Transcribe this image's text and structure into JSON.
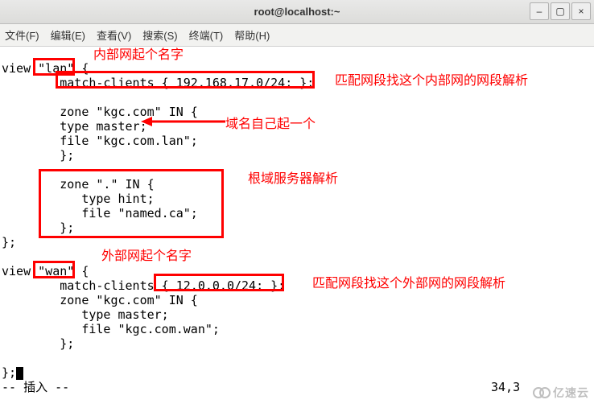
{
  "window": {
    "title": "root@localhost:~",
    "min_icon": "–",
    "max_icon": "▢",
    "close_icon": "×"
  },
  "menubar": {
    "file": "文件(F)",
    "edit": "编辑(E)",
    "view": "查看(V)",
    "search": "搜索(S)",
    "terminal": "终端(T)",
    "help": "帮助(H)"
  },
  "code": {
    "l1": "view \"lan\" {",
    "l2": "        match-clients { 192.168.17.0/24; };",
    "l3": "",
    "l4": "        zone \"kgc.com\" IN {",
    "l5": "        type master;",
    "l6": "        file \"kgc.com.lan\";",
    "l7": "        };",
    "l8": "",
    "l9": "        zone \".\" IN {",
    "l10": "           type hint;",
    "l11": "           file \"named.ca\";",
    "l12": "        };",
    "l13": "};",
    "l14": "",
    "l15": "view \"wan\" {",
    "l16": "        match-clients { 12.0.0.0/24; };",
    "l17": "        zone \"kgc.com\" IN {",
    "l18": "           type master;",
    "l19": "           file \"kgc.com.wan\";",
    "l20": "        };",
    "l21": "",
    "l22": "};"
  },
  "annotations": {
    "lan_name": "内部网起个名字",
    "lan_match": "匹配网段找这个内部网的网段解析",
    "domain_name": "域名自己起一个",
    "root_resolve": "根域服务器解析",
    "wan_name": "外部网起个名字",
    "wan_match": "匹配网段找这个外部网的网段解析"
  },
  "status": {
    "mode": "-- 插入 --",
    "pos": "34,3"
  },
  "watermark": "亿速云"
}
